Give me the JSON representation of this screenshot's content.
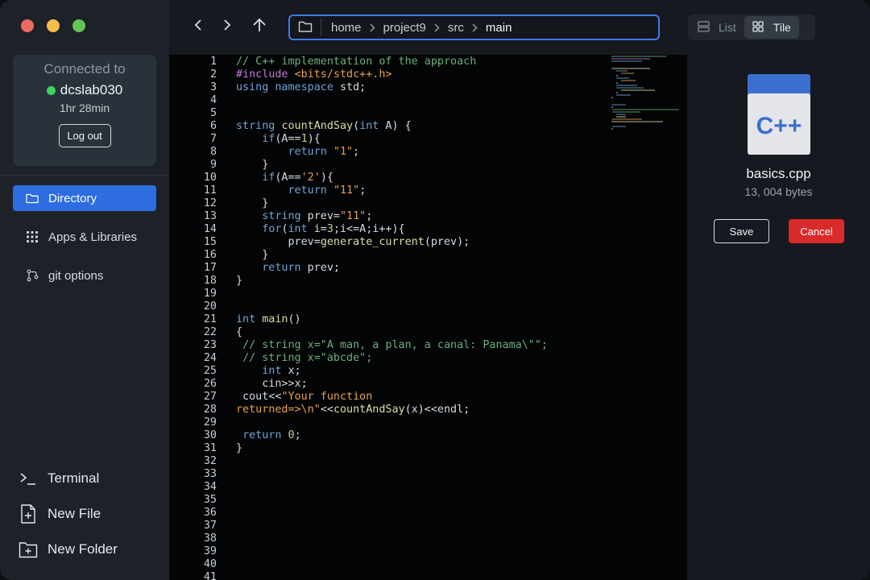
{
  "connection": {
    "title": "Connected to",
    "host": "dcslab030",
    "uptime": "1hr 28min",
    "logout_label": "Log out",
    "status_color": "#3ad65b"
  },
  "sidebar": {
    "items": [
      {
        "label": "Directory",
        "icon": "folder-icon",
        "active": true
      },
      {
        "label": "Apps & Libraries",
        "icon": "apps-grid-icon",
        "active": false
      },
      {
        "label": "git options",
        "icon": "git-branch-icon",
        "active": false
      }
    ],
    "actions": [
      {
        "label": "Terminal",
        "icon": "terminal-icon"
      },
      {
        "label": "New File",
        "icon": "new-file-icon"
      },
      {
        "label": "New Folder",
        "icon": "new-folder-icon"
      }
    ]
  },
  "toolbar": {
    "path": [
      "home",
      "project9",
      "src",
      "main"
    ],
    "view_options": [
      {
        "label": "List",
        "icon": "list-icon",
        "selected": false
      },
      {
        "label": "Tile",
        "icon": "tile-grid-icon",
        "selected": true
      }
    ]
  },
  "editor": {
    "line_numbers": [
      "1",
      "2",
      "3",
      "4",
      "5",
      "6",
      "7",
      "8",
      "9",
      "10",
      "11",
      "12",
      "13",
      "14",
      "15",
      "16",
      "17",
      "18",
      "19",
      "20",
      "21",
      "22",
      "23",
      "24",
      "25",
      "26",
      "27",
      "28",
      "29",
      "30",
      "31",
      "32",
      "33",
      "34",
      "35",
      "36",
      "37",
      "38",
      "39",
      "40",
      "41"
    ],
    "lines": [
      "// C++ implementation of the approach",
      "#include <bits/stdc++.h>",
      "using namespace std;",
      "",
      "",
      "string countAndSay(int A) {",
      "    if(A==1){",
      "        return \"1\";",
      "    }",
      "    if(A=='2'){",
      "        return \"11\";",
      "    }",
      "    string prev=\"11\";",
      "    for(int i=3;i<=A;i++){",
      "        prev=generate_current(prev);",
      "    }",
      "    return prev;",
      "}",
      "",
      "",
      "int main()",
      "{",
      " // string x=\"A man, a plan, a canal: Panama\\\"\";",
      " // string x=\"abcde\";",
      "    int x;",
      "    cin>>x;",
      " cout<<\"Your function",
      "returned=>\\n\"<<countAndSay(x)<<endl;",
      "",
      " return 0;",
      "}",
      "",
      "",
      "",
      "",
      "",
      "",
      "",
      "",
      "",
      ""
    ]
  },
  "file": {
    "badge": "C++",
    "name": "basics.cpp",
    "size": "13, 004 bytes",
    "save_label": "Save",
    "cancel_label": "Cancel",
    "accent": "#3a6fd0",
    "cancel_color": "#d92b2b"
  }
}
